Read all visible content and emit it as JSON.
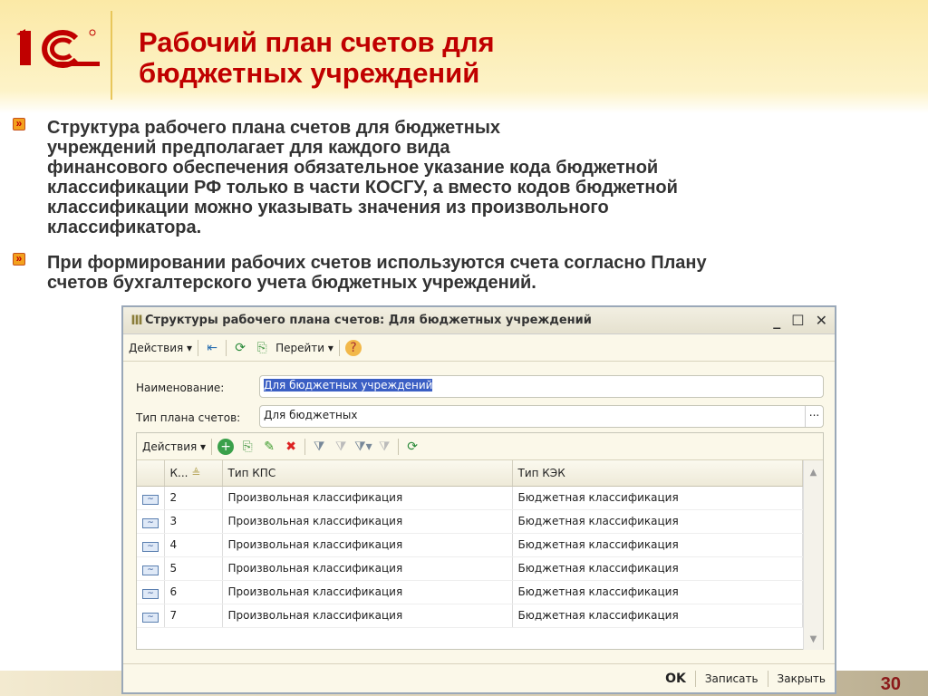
{
  "slide": {
    "title_line1": "Рабочий план счетов для",
    "title_line2": "бюджетных учреждений",
    "logo_text": "1С",
    "page_number": "30",
    "bullets": [
      "Структура рабочего плана счетов для бюджетных\nучреждений предполагает для каждого вида\nфинансового обеспечения обязательное указание кода бюджетной\nклассификации РФ только в части КОСГУ, а вместо кодов бюджетной\nклассификации можно указывать значения из произвольного\nклассификатора.",
      "При формировании рабочих счетов используются счета согласно Плану\nсчетов бухгалтерского учета бюджетных учреждений."
    ]
  },
  "window": {
    "title": "Структуры рабочего плана счетов: Для бюджетных учреждений",
    "toolbar": {
      "actions": "Действия ▾",
      "goto": "Перейти ▾"
    },
    "name_label": "Наименование:",
    "name_value": "Для бюджетных учреждений",
    "type_label": "Тип плана счетов:",
    "type_value": "Для бюджетных",
    "select_btn": "...",
    "table": {
      "actions": "Действия ▾",
      "columns": [
        "К...",
        "Тип КПС",
        "Тип КЭК"
      ],
      "rows": [
        [
          "2",
          "Произвольная классификация",
          "Бюджетная классификация"
        ],
        [
          "3",
          "Произвольная классификация",
          "Бюджетная классификация"
        ],
        [
          "4",
          "Произвольная классификация",
          "Бюджетная классификация"
        ],
        [
          "5",
          "Произвольная классификация",
          "Бюджетная классификация"
        ],
        [
          "6",
          "Произвольная классификация",
          "Бюджетная классификация"
        ],
        [
          "7",
          "Произвольная классификация",
          "Бюджетная классификация"
        ]
      ]
    },
    "buttons": {
      "ok": "OK",
      "save": "Записать",
      "close": "Закрыть"
    }
  }
}
